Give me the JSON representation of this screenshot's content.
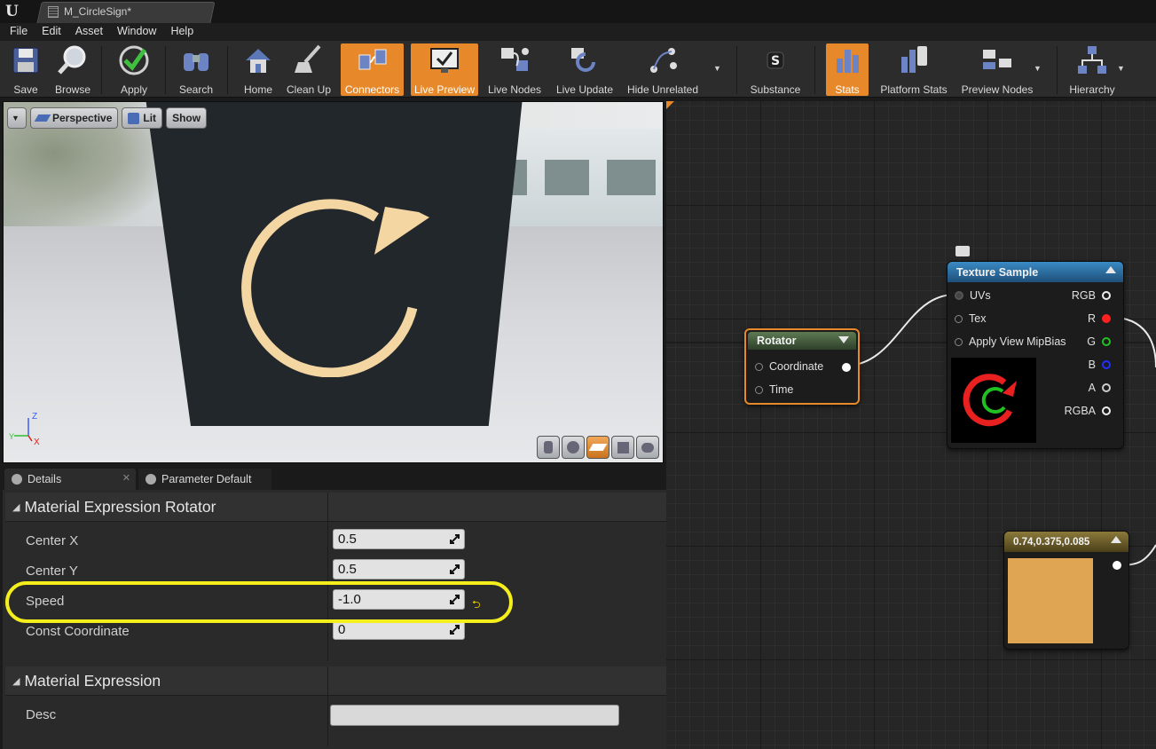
{
  "window": {
    "doc_tab": "M_CircleSign*"
  },
  "menu": [
    "File",
    "Edit",
    "Asset",
    "Window",
    "Help"
  ],
  "toolbar": {
    "save": "Save",
    "browse": "Browse",
    "apply": "Apply",
    "search": "Search",
    "home": "Home",
    "clean_up": "Clean Up",
    "connectors": "Connectors",
    "live_preview": "Live Preview",
    "live_nodes": "Live Nodes",
    "live_update": "Live Update",
    "hide_unrelated": "Hide Unrelated",
    "substance": "Substance",
    "stats": "Stats",
    "platform_stats": "Platform Stats",
    "preview_nodes": "Preview Nodes",
    "hierarchy": "Hierarchy"
  },
  "viewport": {
    "perspective": "Perspective",
    "lit": "Lit",
    "show": "Show",
    "axis_z": "Z",
    "axis_y": "Y",
    "axis_x": "X"
  },
  "details": {
    "tabs": [
      "Details",
      "Parameter Defaults"
    ],
    "section1": "Material Expression Rotator",
    "props": [
      {
        "name": "Center X",
        "value": "0.5"
      },
      {
        "name": "Center Y",
        "value": "0.5"
      },
      {
        "name": "Speed",
        "value": "-1.0"
      },
      {
        "name": "Const Coordinate",
        "value": "0"
      }
    ],
    "section2": "Material Expression",
    "desc_label": "Desc"
  },
  "graph": {
    "texture_node": {
      "title": "Texture Sample",
      "inputs": [
        "UVs",
        "Tex",
        "Apply View MipBias"
      ],
      "outputs": [
        "RGB",
        "R",
        "G",
        "B",
        "A",
        "RGBA"
      ]
    },
    "rotator_node": {
      "title": "Rotator",
      "inputs": [
        "Coordinate",
        "Time"
      ]
    },
    "constant_node": {
      "title": "0.74,0.375,0.085",
      "color": "#e0a552"
    }
  },
  "colors": {
    "accent": "#e7892b",
    "highlight": "#f3ee1c",
    "pin_r": "#ff2020",
    "pin_g": "#22c222",
    "pin_b": "#2030ff"
  }
}
